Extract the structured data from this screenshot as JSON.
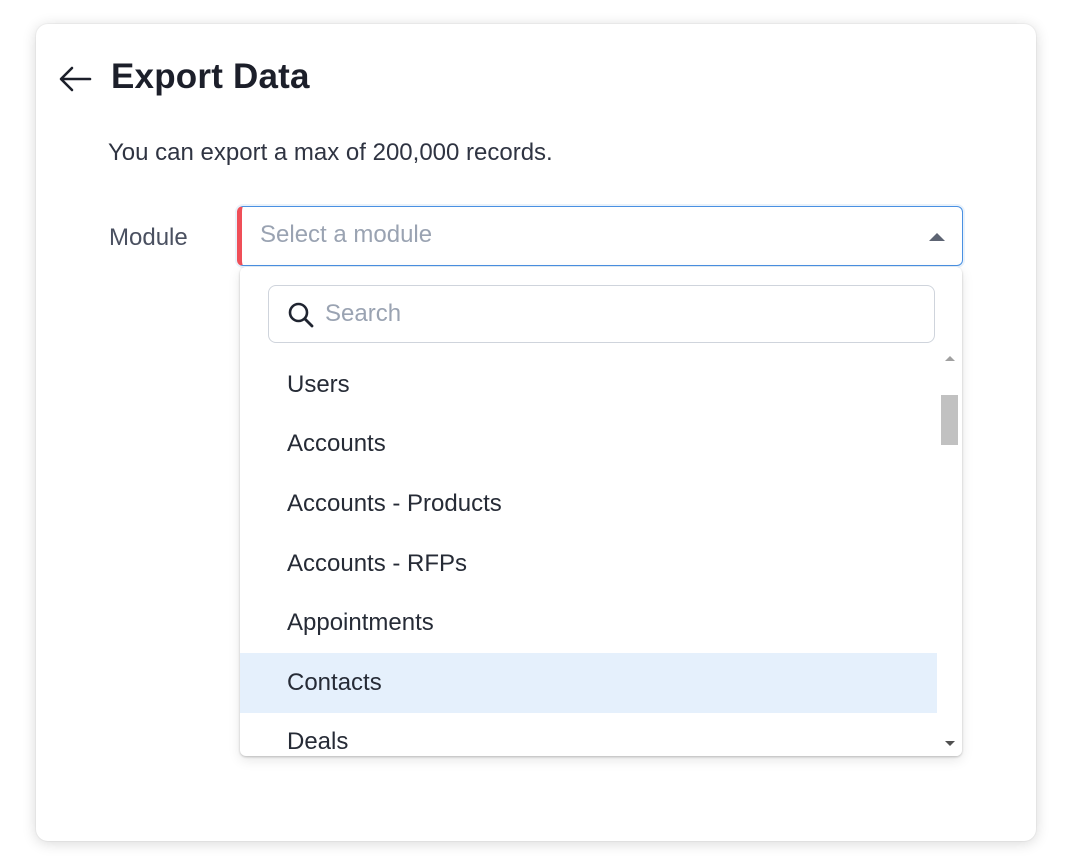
{
  "header": {
    "back_icon": "arrow-left-icon",
    "title": "Export Data"
  },
  "info": {
    "subtitle": "You can export a max of 200,000 records."
  },
  "module_field": {
    "label": "Module",
    "placeholder": "Select a module",
    "caret_icon": "caret-up-icon",
    "required_color": "#ef4f58",
    "focus_color": "#4a90e2"
  },
  "dropdown": {
    "search": {
      "icon": "search-icon",
      "placeholder": "Search",
      "value": ""
    },
    "options": [
      {
        "label": "Users",
        "highlighted": false
      },
      {
        "label": "Accounts",
        "highlighted": false
      },
      {
        "label": "Accounts - Products",
        "highlighted": false
      },
      {
        "label": "Accounts - RFPs",
        "highlighted": false
      },
      {
        "label": "Appointments",
        "highlighted": false
      },
      {
        "label": "Contacts",
        "highlighted": true
      },
      {
        "label": "Deals",
        "highlighted": false
      }
    ],
    "highlight_color": "#e5f0fc"
  }
}
